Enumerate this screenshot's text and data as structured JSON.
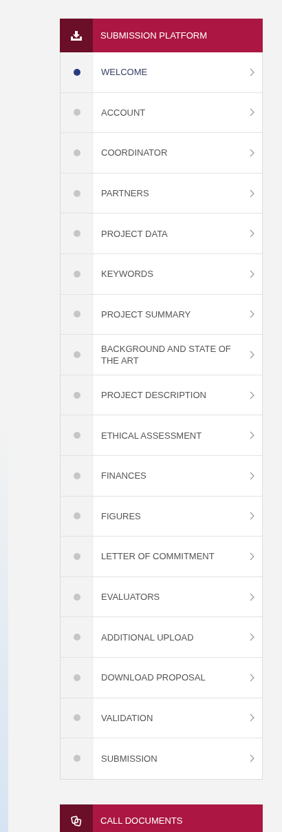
{
  "panels": [
    {
      "title": "SUBMISSION PLATFORM",
      "items": [
        {
          "label": "WELCOME",
          "selected": true
        },
        {
          "label": "ACCOUNT",
          "selected": false
        },
        {
          "label": "COORDINATOR",
          "selected": false
        },
        {
          "label": "PARTNERS",
          "selected": false
        },
        {
          "label": "PROJECT DATA",
          "selected": false
        },
        {
          "label": "KEYWORDS",
          "selected": false
        },
        {
          "label": "PROJECT SUMMARY",
          "selected": false
        },
        {
          "label": "BACKGROUND AND STATE OF THE ART",
          "selected": false
        },
        {
          "label": "PROJECT DESCRIPTION",
          "selected": false
        },
        {
          "label": "ETHICAL ASSESSMENT",
          "selected": false
        },
        {
          "label": "FINANCES",
          "selected": false
        },
        {
          "label": "FIGURES",
          "selected": false
        },
        {
          "label": "LETTER OF COMMITMENT",
          "selected": false
        },
        {
          "label": "EVALUATORS",
          "selected": false
        },
        {
          "label": "ADDITIONAL UPLOAD",
          "selected": false
        },
        {
          "label": "DOWNLOAD PROPOSAL",
          "selected": false
        },
        {
          "label": "VALIDATION",
          "selected": false
        },
        {
          "label": "SUBMISSION",
          "selected": false
        }
      ]
    },
    {
      "title": "CALL DOCUMENTS"
    }
  ]
}
